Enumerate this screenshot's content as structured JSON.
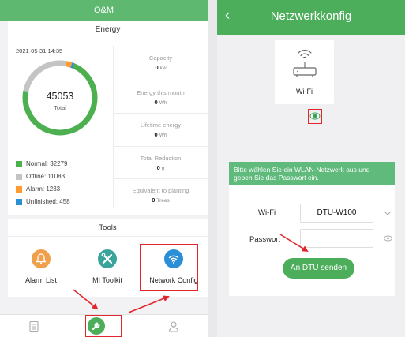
{
  "left": {
    "header_title": "O&M",
    "energy": {
      "section_title": "Energy",
      "date": "2021-05-31 14:35",
      "total_value": "45053",
      "total_label": "Total",
      "ring_fractions": {
        "normal": 0.7165,
        "offline": 0.246,
        "alarm": 0.0274,
        "unfinished": 0.0101
      },
      "legend": [
        {
          "label": "Normal: 32279",
          "color": "#4caf50"
        },
        {
          "label": "Offline: 11083",
          "color": "#c4c4c4"
        },
        {
          "label": "Alarm: 1233",
          "color": "#ff9a2e"
        },
        {
          "label": "Unfinished: 458",
          "color": "#2a8fd6"
        }
      ],
      "stats": [
        {
          "label": "Capacity",
          "value": "0",
          "unit": "kw"
        },
        {
          "label": "Energy this month",
          "value": "0",
          "unit": "Wh"
        },
        {
          "label": "Lifetime energy",
          "value": "0",
          "unit": "Wh"
        },
        {
          "label": "Total Reduction",
          "value": "0",
          "unit": "g"
        },
        {
          "label": "Equivalent to planting",
          "value": "0",
          "unit": "Trees"
        }
      ]
    },
    "tools": {
      "section_title": "Tools",
      "items": [
        {
          "label": "Alarm List",
          "color": "#f0a04b"
        },
        {
          "label": "MI Toolkit",
          "color": "#3aa39b"
        },
        {
          "label": "Network Config",
          "color": "#2a8fd6"
        }
      ]
    }
  },
  "right": {
    "header_title": "Netzwerkkonfig",
    "router_label": "Wi-Fi",
    "dialog": {
      "message": "Bitte wählen Sie ein WLAN-Netzwerk aus und geben Sie das Passwort ein.",
      "wifi_label": "Wi-Fi",
      "wifi_value": "DTU-W100",
      "password_label": "Passwort",
      "password_value": "",
      "send_label": "An DTU senden"
    }
  },
  "colors": {
    "accent": "#4cae5b",
    "highlight": "#e0272d"
  }
}
